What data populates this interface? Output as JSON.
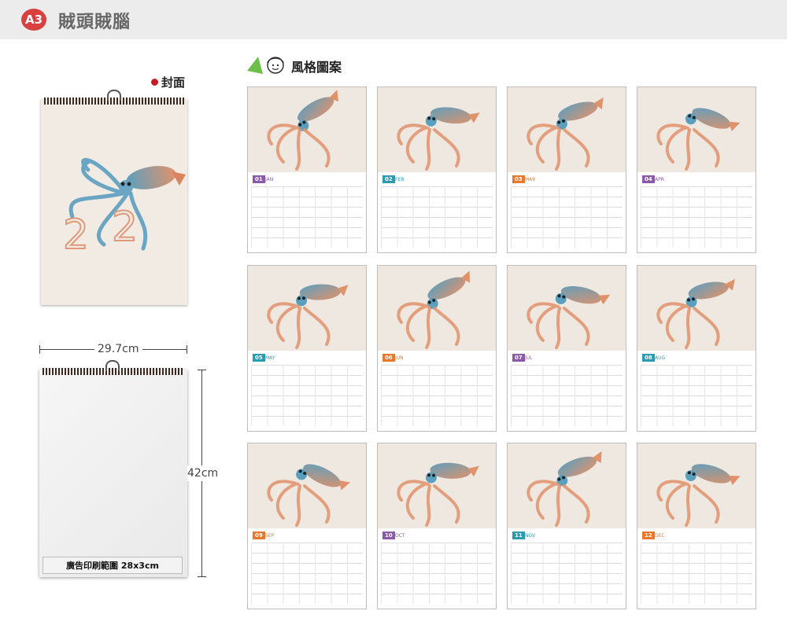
{
  "header": {
    "badge": "A3",
    "title": "賊頭賊腦"
  },
  "cover": {
    "label": "封面"
  },
  "dimensions": {
    "width": "29.7cm",
    "height": "42cm"
  },
  "print_area": {
    "label": "廣告印刷範圍 28x3cm"
  },
  "style": {
    "title": "風格圖案"
  },
  "months": [
    {
      "num": "01",
      "abbr": "JAN",
      "color": "#8b5aa8"
    },
    {
      "num": "02",
      "abbr": "FEB",
      "color": "#2a9bb0"
    },
    {
      "num": "03",
      "abbr": "MAR",
      "color": "#e8782b"
    },
    {
      "num": "04",
      "abbr": "APR",
      "color": "#8b5aa8"
    },
    {
      "num": "05",
      "abbr": "MAY",
      "color": "#2a9bb0"
    },
    {
      "num": "06",
      "abbr": "JUN",
      "color": "#e8782b"
    },
    {
      "num": "07",
      "abbr": "JUL",
      "color": "#8b5aa8"
    },
    {
      "num": "08",
      "abbr": "AUG",
      "color": "#2a9bb0"
    },
    {
      "num": "09",
      "abbr": "SEP",
      "color": "#e8782b"
    },
    {
      "num": "10",
      "abbr": "OCT",
      "color": "#8b5aa8"
    },
    {
      "num": "11",
      "abbr": "NOV",
      "color": "#2a9bb0"
    },
    {
      "num": "12",
      "abbr": "DEC",
      "color": "#e8782b"
    }
  ],
  "colors": {
    "accent_red": "#d8413f",
    "squid_orange": "#e0926b",
    "squid_blue": "#5b9fbf"
  },
  "icons": {
    "style_icon": "green-triangle-face-icon"
  }
}
